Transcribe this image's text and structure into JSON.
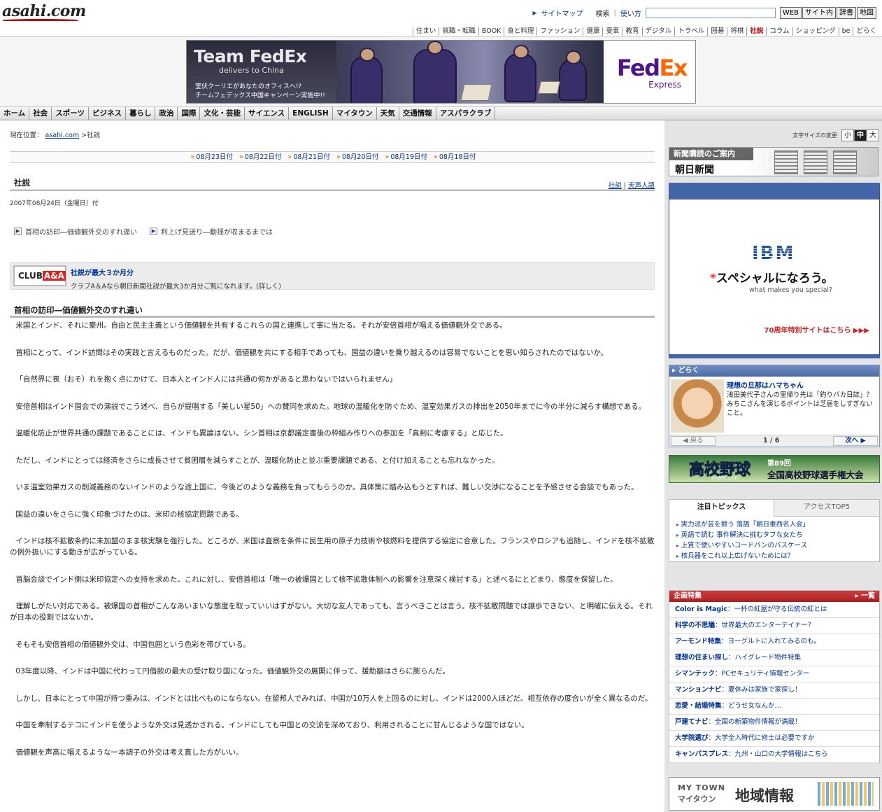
{
  "header": {
    "logo": "asahi.com",
    "sitemap": "サイトマップ",
    "search_label": "検索",
    "howto": "使い方",
    "search_value": "",
    "buttons": [
      "WEB",
      "サイト内",
      "辞書",
      "地図"
    ]
  },
  "category_nav": [
    "住まい",
    "就職・転職",
    "BOOK",
    "食と料理",
    "ファッション",
    "健康",
    "愛車",
    "教育",
    "デジタル",
    "トラベル",
    "囲碁",
    "将棋",
    "社説",
    "コラム",
    "ショッピング",
    "be",
    "どらく"
  ],
  "category_active": "社説",
  "banner": {
    "title": "Team FedEx",
    "subtitle": "delivers to China",
    "copy1": "室伏クーリエがあなたのオフィスへ!?",
    "copy2": "チームフェデックス中国キャンペーン実施中!!",
    "logo_fed": "Fed",
    "logo_ex": "Ex",
    "logo_express": "Express"
  },
  "global_nav": [
    "ホーム",
    "社会",
    "スポーツ",
    "ビジネス",
    "暮らし",
    "政治",
    "国際",
    "文化・芸能",
    "サイエンス",
    "ENGLISH",
    "マイタウン",
    "天気",
    "交通情報",
    "アスパラクラブ"
  ],
  "breadcrumb": {
    "prefix": "現在位置：",
    "home": "asahi.com",
    "current": ">社説"
  },
  "date_links": [
    "08月23日付",
    "08月22日付",
    "08月21日付",
    "08月20日付",
    "08月19日付",
    "08月18日付"
  ],
  "section": {
    "title": "社説",
    "link1": "社説",
    "divider": "|",
    "link2": "天声人語"
  },
  "issue_date": "2007年08月24日（金曜日）付",
  "topics": [
    "首相の訪印―価値観外交のすれ違い",
    "利上げ見送り―動揺が収まるまでは"
  ],
  "club": {
    "logo_a": "CLUB",
    "logo_b": "A&A",
    "title": "社説が最大３か月分",
    "desc": "クラブA＆Aなら朝日新聞社説が最大3か月分ご覧になれます。(詳しく)"
  },
  "article": {
    "title": "首相の訪印―価値観外交のすれ違い",
    "paragraphs": [
      "米国とインド、それに豪州。自由と民主主義という価値観を共有するこれらの国と連携して事に当たる。それが安倍首相が唱える価値観外交である。",
      "首相にとって、インド訪問はその実践と言えるものだった。だが、価値観を共にする相手であっても、国益の違いを乗り越えるのは容易でないことを思い知らされたのではないか。",
      "「自然界に畏（おそ）れを抱く点にかけて、日本人とインド人には共通の何かがあると思わないではいられません」",
      "安倍首相はインド国会での演説でこう述べ、自らが提唱する「美しい星50」への賛同を求めた。地球の温暖化を防ぐため、温室効果ガスの排出を2050年までに今の半分に減らす構想である。",
      "温暖化防止が世界共通の課題であることには、インドも異論はない。シン首相は京都議定書後の枠組み作りへの参加を「真剣に考慮する」と応じた。",
      "ただし、インドにとっては経済をさらに成長させて貧困層を減らすことが、温暖化防止と並ぶ重要課題である、と付け加えることも忘れなかった。",
      "いま温室効果ガスの削減義務のないインドのような途上国に、今後どのような義務を負ってもらうのか。具体策に踏み込もうとすれば、難しい交渉になることを予感させる会談でもあった。",
      "国益の違いをさらに強く印象づけたのは、米印の核協定問題である。",
      "インドは核不拡散条約に未加盟のまま核実験を強行した。ところが、米国は査察を条件に民生用の原子力技術や核燃料を提供する協定に合意した。フランスやロシアも追随し、インドを核不拡散の例外扱いにする動きが広がっている。",
      "首脳会談でインド側は米印協定への支持を求めた。これに対し、安倍首相は「唯一の被爆国として核不拡散体制への影響を注意深く検討する」と述べるにとどまり、態度を保留した。",
      "理解しがたい対応である。被爆国の首相がこんなあいまいな態度を取っていいはずがない。大切な友人であっても、言うべきことは言う。核不拡散問題では譲歩できない、と明確に伝える。それが日本の役割ではないか。",
      "そもそも安倍首相の価値観外交は、中国包囲という色彩を帯びている。",
      "03年度以降、インドは中国に代わって円借款の最大の受け取り国になった。価値観外交の展開に伴って、援助額はさらに膨らんだ。",
      "しかし、日本にとって中国が持つ重みは、インドとは比べものにならない。在留邦人でみれば、中国が10万人を上回るのに対し、インドは2000人ほどだ。相互依存の度合いが全く異なるのだ。",
      "中国を牽制するテコにインドを使うような外交は見透かされる。インドにしても中国との交流を深めており、利用されることに甘んじるような国ではない。",
      "価値観を声高に唱えるような一本調子の外交は考え直した方がいい。"
    ]
  },
  "sidebar": {
    "fontsize_label": "文字サイズの変更",
    "fontsize": [
      "小",
      "中",
      "大"
    ],
    "subscribe_label": "新聞購読のご案内",
    "subscribe_name": "朝日新聞",
    "ibm": {
      "logo": "IBM",
      "star": "*",
      "copy": "スペシャルになろう。",
      "tag": "what makes you special?",
      "link": "70周年特別サイトはこちら ▶▶▶"
    },
    "dokoku": {
      "head": "▸ どらく",
      "title": "理想の旦那はハマちゃん",
      "text": "浅田美代子さんの里帰り先は「釣りバカ日誌」？ みちこさんを演じるポイントは芝居をしすぎないこと。",
      "prev": "◀  戻る",
      "count": "1 / 6",
      "next": "次へ  ▶"
    },
    "koshien": {
      "title": "高校野球",
      "site": "asahi.com",
      "num": "第89回",
      "name": "全国高校野球選手権大会"
    },
    "tabs": [
      "注目トピックス",
      "アクセスTOP5"
    ],
    "topics": [
      "実力派が芸を競う 落語「朝日東西名人会」",
      "英語で読む 事件解決に挑むタフな女たち",
      "上質で使いやすいコードバンのパスケース",
      "核兵器をこれ以上広げないためには？"
    ],
    "kikaku_head": "企画特集",
    "kikaku_all": "▸ 一覧",
    "kikaku": [
      {
        "name": "Color is Magic",
        "text": "：一杯の紅屋が守る伝統の紅とは"
      },
      {
        "name": "科学の不思議",
        "text": "：世界最大のエンターテイナー？"
      },
      {
        "name": "アーモンド特集",
        "text": "：ヨーグルトに入れてみるのも。"
      },
      {
        "name": "理想の住まい探し",
        "text": "：ハイグレード物件特集"
      },
      {
        "name": "シマンテック",
        "text": "：PCセキュリティ情報センター"
      },
      {
        "name": "マンションナビ",
        "text": "：夏休みは家族で家探し！"
      },
      {
        "name": "恋愛・結婚特集",
        "text": "：どうせ女なんか…"
      },
      {
        "name": "戸建てナビ",
        "text": "：全国の新築物件情報が満載！"
      },
      {
        "name": "大学院選び",
        "text": "：大学全入時代に修士は必要ですか"
      },
      {
        "name": "キャンパスプレス",
        "text": "：九州・山口の大学情報はこちら"
      }
    ],
    "mytown": {
      "en": "MY TOWN",
      "ja": "マイタウン",
      "title": "地域情報"
    }
  }
}
